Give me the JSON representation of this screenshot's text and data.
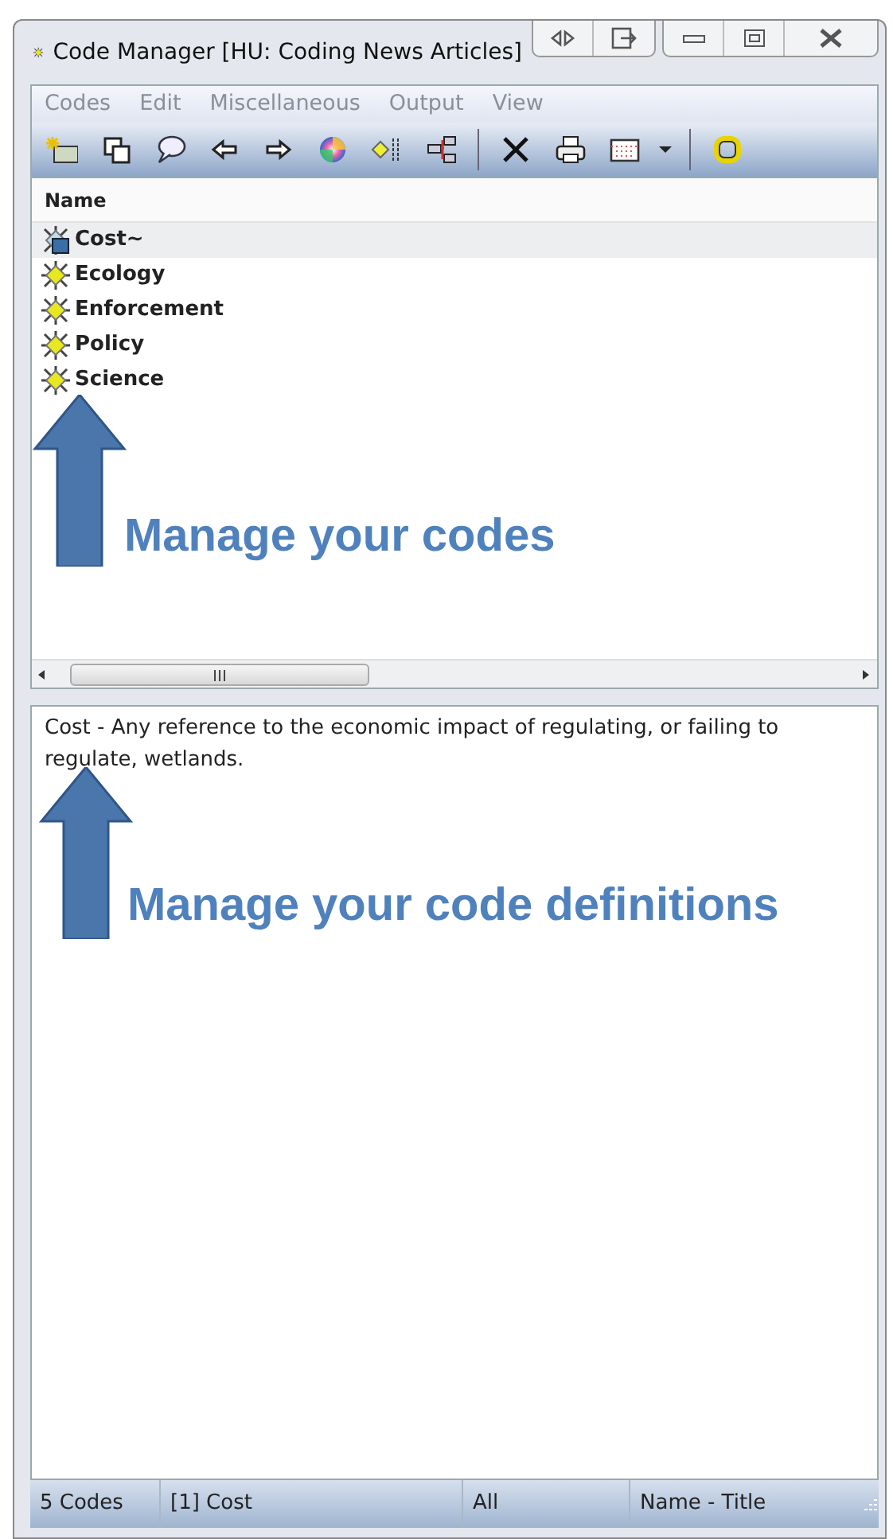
{
  "window": {
    "title": "Code Manager [HU: Coding News Articles]"
  },
  "menu": [
    "Codes",
    "Edit",
    "Miscellaneous",
    "Output",
    "View"
  ],
  "list": {
    "column": "Name",
    "items": [
      {
        "label": "Cost~",
        "kind": "memo",
        "selected": true
      },
      {
        "label": "Ecology",
        "kind": "plain",
        "selected": false
      },
      {
        "label": "Enforcement",
        "kind": "plain",
        "selected": false
      },
      {
        "label": "Policy",
        "kind": "plain",
        "selected": false
      },
      {
        "label": "Science",
        "kind": "plain",
        "selected": false
      }
    ],
    "annotation": "Manage your codes"
  },
  "definition": {
    "text": "Cost - Any reference to the economic impact of regulating, or failing to regulate, wetlands.",
    "annotation": "Manage your code definitions"
  },
  "status_bar": [
    "5 Codes",
    "[1] Cost",
    "All",
    "Name - Title"
  ]
}
